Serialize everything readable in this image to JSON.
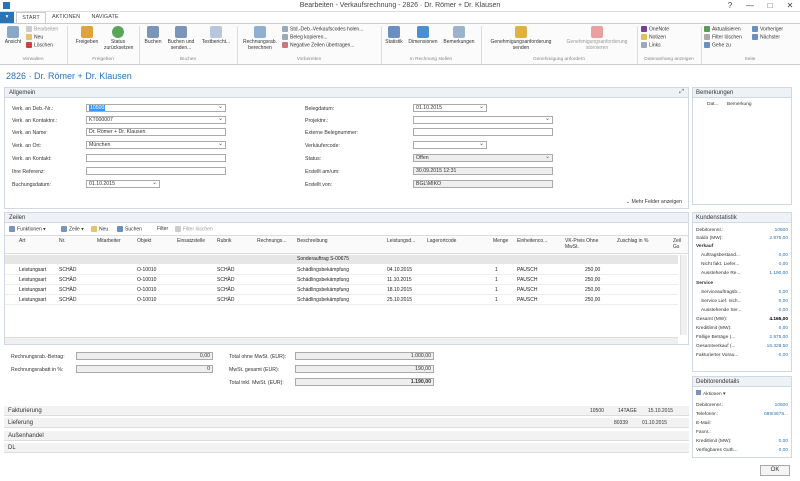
{
  "window": {
    "title": "Bearbeiten - Verkaufsrechnung - 2826 · Dr. Römer + Dr. Klausen",
    "help": "?",
    "minimize": "—",
    "restore": "□",
    "close": "✕"
  },
  "tabs": {
    "file": "",
    "start": "START",
    "aktionen": "AKTIONEN",
    "navigate": "NAVIGATE"
  },
  "ribbon": {
    "ansicht": "Ansicht",
    "bearbeiten": "Bearbeiten",
    "neu": "Neu",
    "loeschen": "Löschen",
    "grp_verwalten": "Verwalten",
    "freigeben": "Freigeben",
    "status": "Status zurücksetzen",
    "grp_freigeben": "Freigeben",
    "buchen": "Buchen",
    "buchen_senden": "Buchen und senden...",
    "testbericht": "Testbericht...",
    "grp_buchen": "Buchen",
    "rechnungsrab": "Rechnungsrab. berechnen",
    "std_deb": "Std.-Deb.-Verkaufscodes holen...",
    "beleg_kop": "Beleg kopieren...",
    "neg_zeilen": "Negative Zeilen übertragen...",
    "grp_vorbereiten": "Vorbereiten",
    "statistik": "Statistik",
    "dimensionen": "Dimensionen",
    "bemerkungen": "Bemerkungen",
    "grp_inrechnung": "In Rechnung stellen",
    "genehm_senden": "Genehmigungsanforderung senden",
    "genehm_storn": "Genehmigungsanforderung stornieren",
    "grp_genehm": "Genehmigung anfordern",
    "onenote": "OneNote",
    "notizen": "Notizen",
    "links": "Links",
    "grp_daten": "Datenanhang anzeigen",
    "aktualisieren": "Aktualisieren",
    "filter_loeschen": "Filter löschen",
    "gehe_zu": "Gehe zu",
    "vorheriger": "Vorheriger",
    "naechster": "Nächster",
    "grp_seite": "Seite"
  },
  "page_title": "2826 · Dr. Römer + Dr. Klausen",
  "allgemein": {
    "header": "Allgemein",
    "deb_nr_label": "Verk. an Deb.-Nr.:",
    "deb_nr": "10500",
    "kontakt_nr_label": "Verk. an Kontaktnr.:",
    "kontakt_nr": "KT000007",
    "name_label": "Verk. an Name:",
    "name": "Dr. Römer + Dr. Klausen",
    "ort_label": "Verk. an Ort:",
    "ort": "München",
    "kontakt_label": "Verk. an Kontakt:",
    "kontakt": "",
    "referenz_label": "Ihre Referenz:",
    "referenz": "",
    "buchungsdatum_label": "Buchungsdatum:",
    "buchungsdatum": "01.10.2015",
    "belegdatum_label": "Belegdatum:",
    "belegdatum": "01.10.2015",
    "projektnr_label": "Projektnr.:",
    "projektnr": "",
    "ext_beleg_label": "Externe Belegnummer:",
    "ext_beleg": "",
    "verkaeufer_label": "Verkäufercode:",
    "verkaeufer": "",
    "status_label": "Status:",
    "status": "Offen",
    "erstellt_am_label": "Erstellt am/um:",
    "erstellt_am": "30.09.2015 12:31",
    "erstellt_von_label": "Erstellt von:",
    "erstellt_von": "BGL\\MIKO",
    "mehr": "Mehr Felder anzeigen"
  },
  "zeilen": {
    "header": "Zeilen",
    "toolbar": {
      "funktionen": "Funktionen",
      "zeile": "Zeile",
      "neu": "Neu",
      "suchen": "Suchen",
      "filter": "Filter",
      "filter_loeschen": "Filter löschen"
    },
    "columns": [
      "Art",
      "Nr.",
      "Mitarbeiter",
      "Objekt",
      "Einsatzstelle",
      "Rubrik",
      "Rechnungs...",
      "Beschreibung",
      "Leistungsd...",
      "Lagerortcode",
      "Menge",
      "Einheitenco...",
      "VK-Preis Ohne MwSt.",
      "Zuschlag in %",
      "Zeil Gs"
    ],
    "group": "Sonderauftrag S-00675",
    "rows": [
      {
        "art": "Leistungsart",
        "nr": "SCHÄD",
        "objekt": "O-10010",
        "rubrik": "SCHÄD",
        "beschreibung": "Schädlingsbekämpfung",
        "datum": "04.10.2015",
        "menge": "1",
        "einheit": "PAUSCH",
        "preis": "250,00"
      },
      {
        "art": "Leistungsart",
        "nr": "SCHÄD",
        "objekt": "O-10010",
        "rubrik": "SCHÄD",
        "beschreibung": "Schädlingsbekämpfung",
        "datum": "11.10.2015",
        "menge": "1",
        "einheit": "PAUSCH",
        "preis": "250,00"
      },
      {
        "art": "Leistungsart",
        "nr": "SCHÄD",
        "objekt": "O-10010",
        "rubrik": "SCHÄD",
        "beschreibung": "Schädlingsbekämpfung",
        "datum": "18.10.2015",
        "menge": "1",
        "einheit": "PAUSCH",
        "preis": "250,00"
      },
      {
        "art": "Leistungsart",
        "nr": "SCHÄD",
        "objekt": "O-10010",
        "rubrik": "SCHÄD",
        "beschreibung": "Schädlingsbekämpfung",
        "datum": "25.10.2015",
        "menge": "1",
        "einheit": "PAUSCH",
        "preis": "250,00"
      }
    ]
  },
  "totals": {
    "rab_betrag_label": "Rechnungsrab.-Betrag:",
    "rab_betrag": "0,00",
    "rab_proz_label": "Rechnungsrabatt in %:",
    "rab_proz": "0",
    "ohne_label": "Total ohne MwSt. (EUR):",
    "ohne": "1.000,00",
    "mwst_label": "MwSt. gesamt (EUR):",
    "mwst": "190,00",
    "inkl_label": "Total inkl. MwSt. (EUR):",
    "inkl": "1.190,00"
  },
  "footer": {
    "fakturierung": "Fakturierung",
    "fak_deb": "10500",
    "fak_zahl": "14TAGE",
    "fak_datum": "15.10.2015",
    "lieferung": "Lieferung",
    "lief_nr": "80339",
    "lief_datum": "01.10.2015",
    "aussenhandel": "Außenhandel",
    "dl": "DL"
  },
  "right": {
    "bemerkungen": {
      "header": "Bemerkungen",
      "col_dat": "Dat...",
      "col_bem": "Bemerkung"
    },
    "kunden": {
      "header": "Kundenstatistik",
      "debnr_label": "Debitorennr.:",
      "debnr": "10500",
      "saldo_label": "Saldo (MW):",
      "saldo": "2.975,00",
      "verkauf": "Verkauf",
      "auftrag_label": "Auftragsbestand...",
      "auftrag": "0,00",
      "nicht_label": "Nicht fakt. Liefer...",
      "nicht": "0,00",
      "ausst_label": "Ausstehende Re...",
      "ausst": "1.190,00",
      "service": "Service",
      "sauftrag_label": "Serviceauftragsb...",
      "sauftrag": "0,00",
      "slief_label": "Service Lief. nich...",
      "slief": "0,00",
      "sausst_label": "Ausstehende Ser...",
      "sausst": "0,00",
      "gesamt_label": "Gesamt (MW):",
      "gesamt": "4.165,00",
      "kredit_label": "Kreditlimit (MW):",
      "kredit": "0,00",
      "faellig_label": "Fällige Beträge (...",
      "faellig": "2.975,00",
      "gesamtv_label": "Gesamtverkauf (...",
      "gesamtv": "16.328,50",
      "fakt_label": "Fakturierter Vorau...",
      "fakt": "0,00"
    },
    "debdet": {
      "header": "Debitorendetails",
      "aktionen": "Aktionen",
      "debnr_label": "Debitorennr.:",
      "debnr": "10500",
      "tel_label": "Telefonnr.:",
      "tel": "089/4678...",
      "email_label": "E-Mail:",
      "email": "",
      "fax_label": "Faxnr.:",
      "fax": "",
      "kredit_label": "Kreditlimit (MW):",
      "kredit": "0,00",
      "verf_label": "Verfügbares Guth...",
      "verf": "0,00"
    }
  },
  "ok": "OK"
}
